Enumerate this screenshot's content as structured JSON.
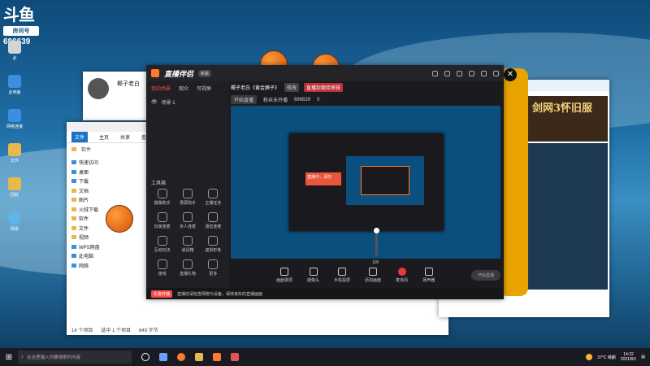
{
  "watermark": {
    "logo": "斗鱼",
    "sub": "房间号",
    "room": "696639"
  },
  "desktop_icons": [
    "此",
    "此电脑",
    "网络连接",
    "文件",
    "回收",
    "网易"
  ],
  "profile_window": {
    "name": "椰子老白"
  },
  "explorer": {
    "title_tabs": [
      "文件",
      "主页",
      "共享",
      "查看"
    ],
    "address": "软件",
    "sidebar": [
      "快速访问",
      "桌面",
      "下载",
      "文档",
      "图片",
      "火绒下载",
      "软件",
      "文件",
      "视频",
      "WPS网盘",
      "此电脑",
      "网络"
    ],
    "status_items": "14 个项目",
    "status_selected": "选中 1 个项目",
    "status_size": "649 字节"
  },
  "app": {
    "logo": "直播伴侣",
    "version": "新版",
    "tabs": [
      "我的场景",
      "观众",
      "可视屏"
    ],
    "scene_label": "场景 1",
    "tools_label": "工具箱",
    "tools": [
      "摄像助手",
      "录屏助手",
      "主播任务",
      "玩家连麦",
      "多人连麦",
      "语音连麦",
      "互动玩法",
      "道具箱",
      "虚拟形象",
      "连线",
      "直播礼物",
      "更多"
    ],
    "room_title": "椰子老白《黄金狮子》",
    "room_tag": "修改",
    "red_tag": "直播封面待审核",
    "live_btn": "开始直播",
    "stats_label": "粉丝未开播",
    "room_no": "696639",
    "count": "0",
    "preview_overlay": "直播中，请勿",
    "volume": "100",
    "controls": [
      "画面录屏",
      "摄像头",
      "手机投屏",
      "添加画面",
      "麦克风",
      "扬声器"
    ],
    "start_button": "开始直播",
    "bottom_label": "头像开播",
    "bottom_text": "直播前请检查网络与设备，保持良好的直播画面"
  },
  "game_banner": {
    "text": "剑网3怀旧服"
  },
  "taskbar": {
    "search_placeholder": "在这里输入你要搜索的内容",
    "weather": "37°C 晴朗",
    "time": "14:22",
    "date": "2021/8/1"
  }
}
